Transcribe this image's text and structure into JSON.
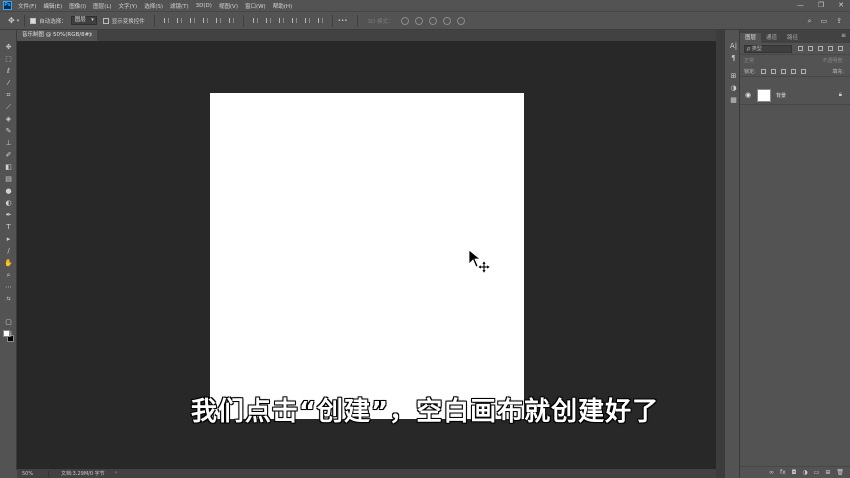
{
  "menu": {
    "logo": "Ps",
    "items": [
      "文件(F)",
      "编辑(E)",
      "图像(I)",
      "图层(L)",
      "文字(Y)",
      "选择(S)",
      "滤镜(T)",
      "3D(D)",
      "视图(V)",
      "窗口(W)",
      "帮助(H)"
    ],
    "window_controls": [
      "—",
      "❐",
      "✕"
    ]
  },
  "options": {
    "move_icon": "move-tool-icon",
    "auto_select_label": "自动选择：",
    "auto_select_checked": true,
    "auto_select_value": "图层",
    "transform_label": "显示变换控件",
    "transform_checked": false,
    "mode_3d_label": "3D 模式："
  },
  "document": {
    "tab_title": "音乐制图 @ 50%(RGB/8#)",
    "close": "×",
    "canvas_color": "#ffffff"
  },
  "subtitle": "我们点击“创建”，空白画布就创建好了",
  "status": {
    "zoom": "50%",
    "doc_info": "文档:3.29M/0 字节",
    "arrow": "›"
  },
  "layers_panel": {
    "tabs": [
      "图层",
      "通道",
      "路径"
    ],
    "active_tab": 0,
    "menu": "≡",
    "filter_placeholder": "ρ 类型",
    "blend_mode": "正常",
    "opacity_label": "不透明度:",
    "lock_label": "锁定:",
    "fill_label": "填充:",
    "layer_name": "背景",
    "footer_icons": [
      "link-icon",
      "fx-icon",
      "mask-icon",
      "adjustment-icon",
      "folder-icon",
      "new-layer-icon",
      "trash-icon"
    ]
  },
  "tools": [
    "move-tool",
    "marquee-tool",
    "lasso-tool",
    "magic-wand-tool",
    "crop-tool",
    "eyedropper-tool",
    "healing-tool",
    "brush-tool",
    "stamp-tool",
    "history-brush-tool",
    "eraser-tool",
    "gradient-tool",
    "dodge-tool",
    "pen-tool",
    "type-tool",
    "path-select-tool",
    "line-tool",
    "hand-tool",
    "zoom-tool",
    "more-tools"
  ],
  "colors": {
    "workspace_bg": "#282828",
    "panel_bg": "#535353",
    "foreground_swatch": "#ffffff",
    "background_swatch": "#000000"
  }
}
